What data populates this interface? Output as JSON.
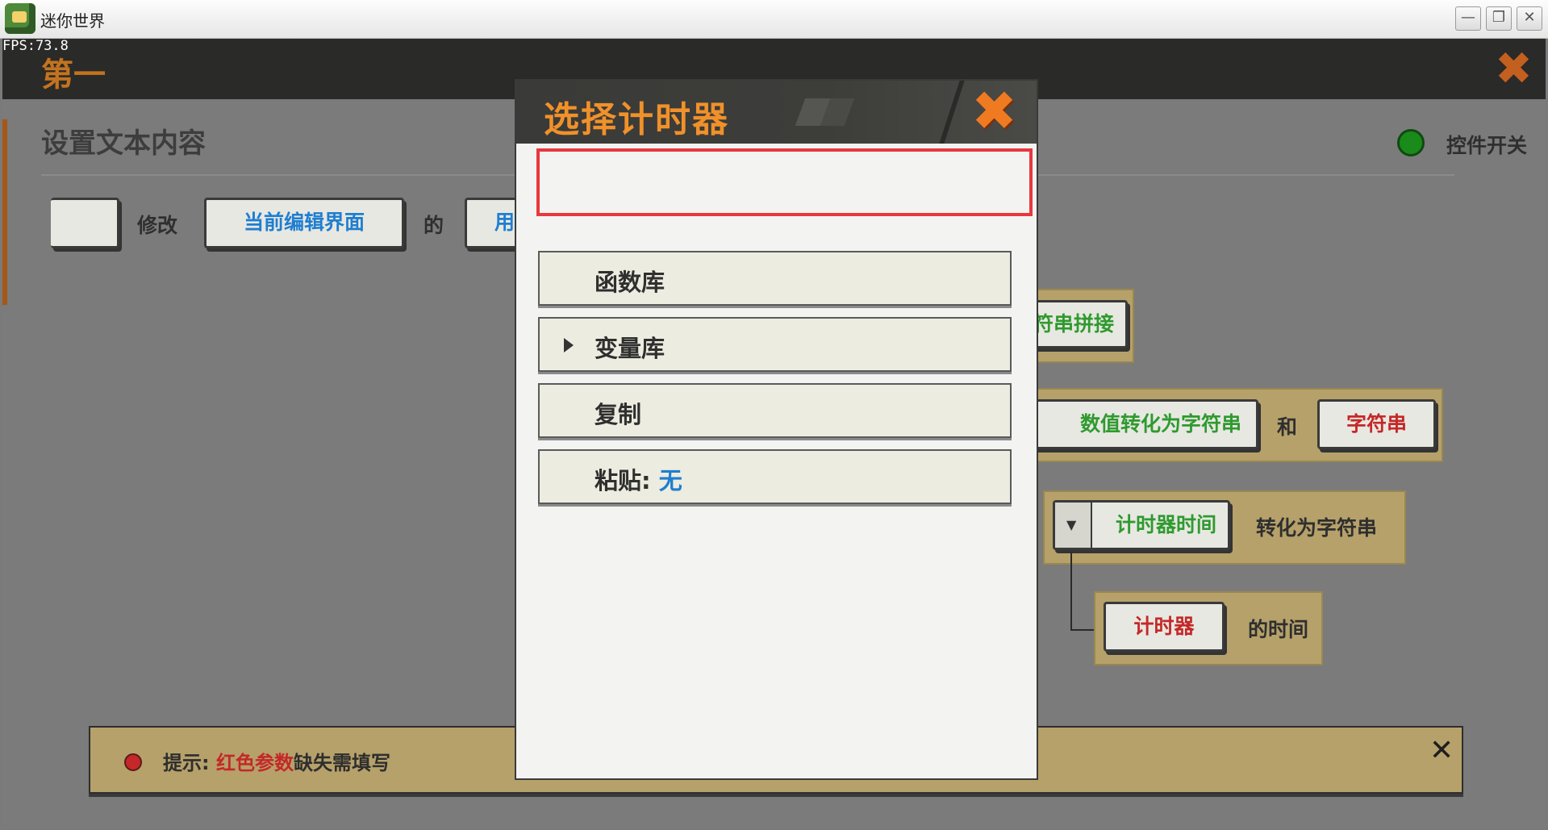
{
  "window": {
    "title": "迷你世界",
    "minimize_glyph": "—",
    "restore_glyph": "❐",
    "close_glyph": "✕"
  },
  "fps": "FPS:73.8",
  "background": {
    "top_title": "第一",
    "top_close_glyph": "✖",
    "panel_heading": "设置文本内容",
    "toggle_label": "控件开关",
    "row1": {
      "modify": "修改",
      "current_ui": "当前编辑界面",
      "of": "的",
      "partial_chip": "用"
    },
    "blocks": {
      "string_concat": "符串拼接",
      "num_to_string": "数值转化为字符串",
      "and": "和",
      "string": "字符串",
      "timer_time": "计时器时间",
      "convert_to_string": "转化为字符串",
      "timer": "计时器",
      "its_time": "的时间"
    },
    "hint": {
      "prefix": "提示: ",
      "red_params": "红色参数",
      "suffix": "缺失需填写",
      "close_glyph": "✕"
    }
  },
  "modal": {
    "title": "选择计时器",
    "close_glyph": "✖",
    "items": [
      {
        "label": "函数库",
        "has_arrow": false
      },
      {
        "label": "变量库",
        "has_arrow": true
      },
      {
        "label": "复制",
        "has_arrow": false
      },
      {
        "label": "粘贴: ",
        "value": "无",
        "has_arrow": false
      }
    ]
  },
  "colors": {
    "accent_orange": "#f0912a",
    "highlight_red": "#e8383d",
    "link_blue": "#1f7ed0",
    "param_green": "#2f9a2f",
    "param_red": "#c42828"
  }
}
